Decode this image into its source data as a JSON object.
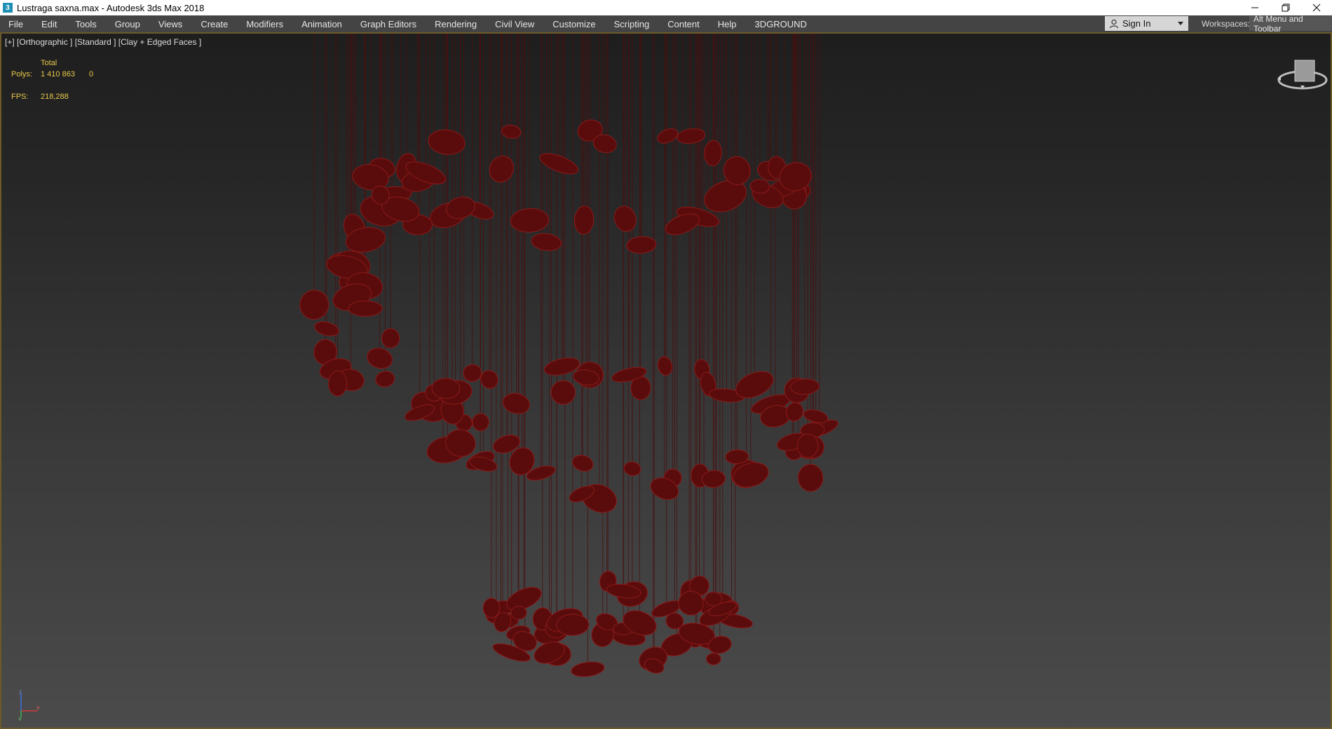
{
  "window": {
    "title": "Lustraga saxna.max - Autodesk 3ds Max 2018",
    "app_icon_glyph": "3",
    "controls": [
      "minimize-icon",
      "restore-icon",
      "close-icon"
    ]
  },
  "menubar": {
    "items": [
      {
        "label": "File"
      },
      {
        "label": "Edit"
      },
      {
        "label": "Tools"
      },
      {
        "label": "Group"
      },
      {
        "label": "Views"
      },
      {
        "label": "Create"
      },
      {
        "label": "Modifiers"
      },
      {
        "label": "Animation"
      },
      {
        "label": "Graph Editors"
      },
      {
        "label": "Rendering"
      },
      {
        "label": "Civil View"
      },
      {
        "label": "Customize"
      },
      {
        "label": "Scripting"
      },
      {
        "label": "Content"
      },
      {
        "label": "Help"
      },
      {
        "label": "3DGROUND"
      }
    ],
    "signin_label": "Sign In",
    "workspaces_label": "Workspaces:",
    "workspaces_value": "Alt Menu and Toolbar"
  },
  "viewport": {
    "label": "[+] [Orthographic ] [Standard ] [Clay + Edged Faces ]",
    "stats": {
      "total_label": "Total",
      "polys_label": "Polys:",
      "polys_value": "1 410 863",
      "polys_selected": "0",
      "fps_label": "FPS:",
      "fps_value": "218,288"
    },
    "axis_labels": {
      "z": "z",
      "x": "x",
      "y": "y"
    }
  },
  "colors": {
    "menubar_bg": "#444444",
    "accent_border": "#6b5a2a",
    "stats_text": "#e8c84a",
    "model_fill": "#5a0c0c",
    "model_wire": "#8a1a1a"
  }
}
